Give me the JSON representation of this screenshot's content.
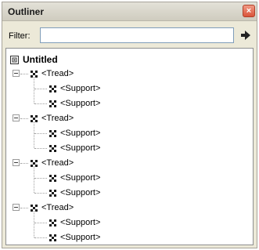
{
  "window": {
    "title": "Outliner",
    "close_glyph": "×"
  },
  "filter": {
    "label": "Filter:",
    "value": "",
    "placeholder": "",
    "button_icon": "arrow-right-icon"
  },
  "tree": {
    "root": {
      "label": "Untitled",
      "icon": "model-icon"
    },
    "groups": [
      {
        "label": "<Tread>",
        "icon": "component-icon",
        "expanded": true,
        "children": [
          {
            "label": "<Support>",
            "icon": "component-icon"
          },
          {
            "label": "<Support>",
            "icon": "component-icon"
          }
        ]
      },
      {
        "label": "<Tread>",
        "icon": "component-icon",
        "expanded": true,
        "children": [
          {
            "label": "<Support>",
            "icon": "component-icon"
          },
          {
            "label": "<Support>",
            "icon": "component-icon"
          }
        ]
      },
      {
        "label": "<Tread>",
        "icon": "component-icon",
        "expanded": true,
        "children": [
          {
            "label": "<Support>",
            "icon": "component-icon"
          },
          {
            "label": "<Support>",
            "icon": "component-icon"
          }
        ]
      },
      {
        "label": "<Tread>",
        "icon": "component-icon",
        "expanded": true,
        "children": [
          {
            "label": "<Support>",
            "icon": "component-icon"
          },
          {
            "label": "<Support>",
            "icon": "component-icon"
          }
        ]
      }
    ]
  }
}
